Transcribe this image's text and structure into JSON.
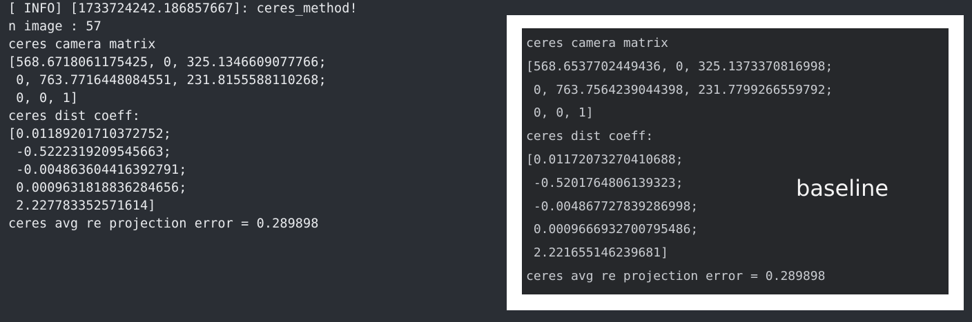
{
  "terminal": {
    "lines": [
      "[ INFO] [1733724242.186857667]: ceres_method!",
      "n image : 57",
      "ceres camera matrix",
      "[568.6718061175425, 0, 325.1346609077766;",
      " 0, 763.7716448084551, 231.8155588110268;",
      " 0, 0, 1]",
      "ceres dist coeff:",
      "[0.01189201710372752;",
      " -0.5222319209545663;",
      " -0.004863604416392791;",
      " 0.0009631818836284656;",
      " 2.227783352571614]",
      "ceres avg re projection error = 0.289898"
    ]
  },
  "overlay": {
    "label": "baseline",
    "lines": [
      "ceres camera matrix",
      "[568.6537702449436, 0, 325.1373370816998;",
      " 0, 763.7564239044398, 231.7799266559792;",
      " 0, 0, 1]",
      "ceres dist coeff:",
      "[0.01172073270410688;",
      " -0.5201764806139323;",
      " -0.004867727839286998;",
      " 0.0009666932700795486;",
      " 2.221655146239681]",
      "ceres avg re projection error = 0.289898"
    ]
  }
}
